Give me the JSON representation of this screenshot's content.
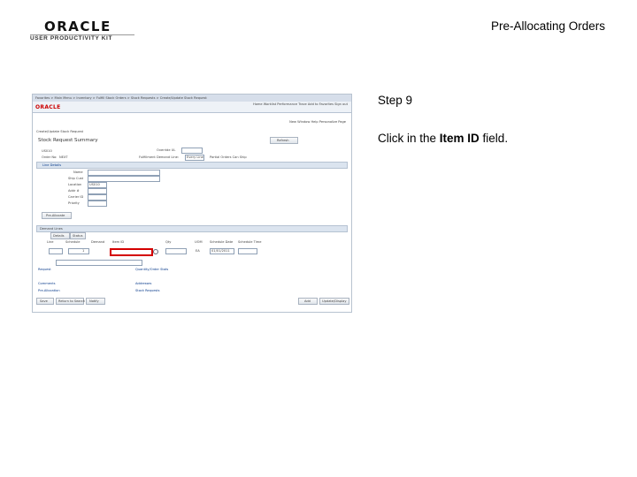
{
  "header": {
    "logo_main": "ORACLE",
    "logo_sub": "USER PRODUCTIVITY KIT",
    "slide_title": "Pre-Allocating Orders"
  },
  "step": {
    "label": "Step 9",
    "instruction_prefix": "Click in the ",
    "instruction_target": "Item ID",
    "instruction_suffix": " field."
  },
  "screenshot": {
    "menu": {
      "breadcrumb": "Favorites  >  Main Menu  >  Inventory  >  Fulfill Stock Orders  >  Stock Requests  >  Create/Update Stock Request"
    },
    "brand": "ORACLE",
    "nav_links": "Home   Worklist   Performance Trace   Add to Favorites   Sign out",
    "top_links": "New Window  Help  Personalize Page",
    "breadcrumb_title": "Create/Update Stock Request",
    "page_title": "Stock Request Summary",
    "unit_value": "US010",
    "order_no_label": "Order No:",
    "order_no_value": "NEXT",
    "override_label": "Override UL",
    "fulfillment_label": "Fulfillment Demand Line:",
    "fulfillment_value": "Every Line",
    "partial_label": "Partial Orders Can Ship",
    "refresh_button": "Refresh",
    "line_details": "Line Details",
    "fields": [
      {
        "label": "Name"
      },
      {
        "label": "Ship Cust"
      },
      {
        "label": "Location",
        "value": "US010"
      },
      {
        "label": "Addr #",
        "value": "1"
      },
      {
        "label": "Carrier ID"
      },
      {
        "label": "Priority",
        "value": ""
      }
    ],
    "header_button": "Pre-Allocate",
    "section_title": "Demand Lines",
    "tabs": [
      "Details",
      "Status"
    ],
    "columns": [
      "Line",
      "Schedule",
      "Demand",
      "Item ID",
      "Qty",
      "UOM",
      "Schedule Date",
      "Schedule Time"
    ],
    "row_num": "1",
    "row_uom": "EA",
    "row_date": "01/01/2011",
    "links": [
      "Request",
      "Quantity/Order Stats",
      "Comments",
      "Addresses",
      "Pre-Allocation",
      "Stock Requests"
    ],
    "bottom_buttons": [
      "Save",
      "Return to Search",
      "Notify",
      "Add",
      "Update/Display"
    ]
  }
}
